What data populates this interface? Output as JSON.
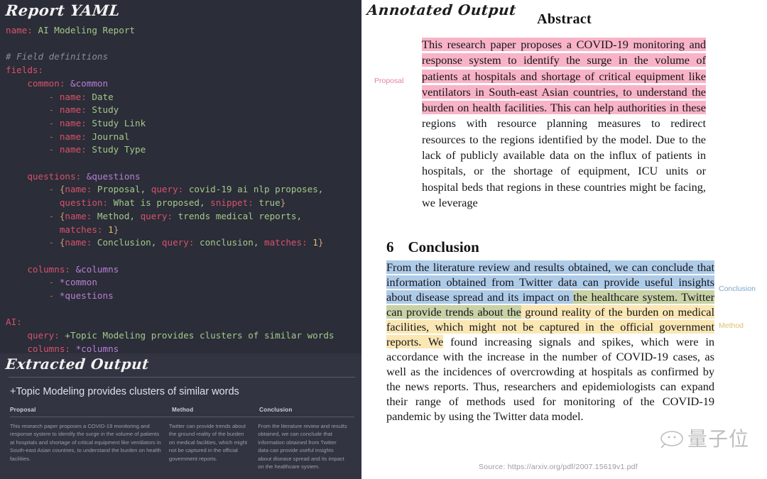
{
  "left": {
    "yaml_panel_title": "Report YAML",
    "yaml_lines": [
      {
        "parts": [
          {
            "t": "name:",
            "c": "k"
          },
          {
            "t": " AI Modeling Report",
            "c": "v"
          }
        ]
      },
      {
        "parts": []
      },
      {
        "parts": [
          {
            "t": "# Field definitions",
            "c": "cm"
          }
        ]
      },
      {
        "parts": [
          {
            "t": "fields:",
            "c": "k"
          }
        ]
      },
      {
        "parts": [
          {
            "t": "    common:",
            "c": "k"
          },
          {
            "t": " ",
            "c": "plain"
          },
          {
            "t": "&common",
            "c": "anch"
          }
        ]
      },
      {
        "parts": [
          {
            "t": "        - ",
            "c": "dash"
          },
          {
            "t": "name:",
            "c": "k"
          },
          {
            "t": " Date",
            "c": "v"
          }
        ]
      },
      {
        "parts": [
          {
            "t": "        - ",
            "c": "dash"
          },
          {
            "t": "name:",
            "c": "k"
          },
          {
            "t": " Study",
            "c": "v"
          }
        ]
      },
      {
        "parts": [
          {
            "t": "        - ",
            "c": "dash"
          },
          {
            "t": "name:",
            "c": "k"
          },
          {
            "t": " Study Link",
            "c": "v"
          }
        ]
      },
      {
        "parts": [
          {
            "t": "        - ",
            "c": "dash"
          },
          {
            "t": "name:",
            "c": "k"
          },
          {
            "t": " Journal",
            "c": "v"
          }
        ]
      },
      {
        "parts": [
          {
            "t": "        - ",
            "c": "dash"
          },
          {
            "t": "name:",
            "c": "k"
          },
          {
            "t": " Study Type",
            "c": "v"
          }
        ]
      },
      {
        "parts": []
      },
      {
        "parts": [
          {
            "t": "    questions:",
            "c": "k"
          },
          {
            "t": " ",
            "c": "plain"
          },
          {
            "t": "&questions",
            "c": "anch"
          }
        ]
      },
      {
        "parts": [
          {
            "t": "        - ",
            "c": "dash"
          },
          {
            "t": "{",
            "c": "punc"
          },
          {
            "t": "name:",
            "c": "k"
          },
          {
            "t": " Proposal, ",
            "c": "v"
          },
          {
            "t": "query:",
            "c": "k"
          },
          {
            "t": " covid-19 ai nlp proposes,",
            "c": "v"
          }
        ]
      },
      {
        "parts": [
          {
            "t": "          ",
            "c": "plain"
          },
          {
            "t": "question:",
            "c": "k"
          },
          {
            "t": " What is proposed, ",
            "c": "v"
          },
          {
            "t": "snippet:",
            "c": "k"
          },
          {
            "t": " true",
            "c": "v"
          },
          {
            "t": "}",
            "c": "punc"
          }
        ]
      },
      {
        "parts": [
          {
            "t": "        - ",
            "c": "dash"
          },
          {
            "t": "{",
            "c": "punc"
          },
          {
            "t": "name:",
            "c": "k"
          },
          {
            "t": " Method, ",
            "c": "v"
          },
          {
            "t": "query:",
            "c": "k"
          },
          {
            "t": " trends medical reports,",
            "c": "v"
          }
        ]
      },
      {
        "parts": [
          {
            "t": "          ",
            "c": "plain"
          },
          {
            "t": "matches:",
            "c": "k"
          },
          {
            "t": " ",
            "c": "v"
          },
          {
            "t": "1",
            "c": "num"
          },
          {
            "t": "}",
            "c": "punc"
          }
        ]
      },
      {
        "parts": [
          {
            "t": "        - ",
            "c": "dash"
          },
          {
            "t": "{",
            "c": "punc"
          },
          {
            "t": "name:",
            "c": "k"
          },
          {
            "t": " Conclusion, ",
            "c": "v"
          },
          {
            "t": "query:",
            "c": "k"
          },
          {
            "t": " conclusion, ",
            "c": "v"
          },
          {
            "t": "matches:",
            "c": "k"
          },
          {
            "t": " ",
            "c": "v"
          },
          {
            "t": "1",
            "c": "num"
          },
          {
            "t": "}",
            "c": "punc"
          }
        ]
      },
      {
        "parts": []
      },
      {
        "parts": [
          {
            "t": "    columns:",
            "c": "k"
          },
          {
            "t": " ",
            "c": "plain"
          },
          {
            "t": "&columns",
            "c": "anch"
          }
        ]
      },
      {
        "parts": [
          {
            "t": "        - ",
            "c": "dash"
          },
          {
            "t": "*common",
            "c": "anch"
          }
        ]
      },
      {
        "parts": [
          {
            "t": "        - ",
            "c": "dash"
          },
          {
            "t": "*questions",
            "c": "anch"
          }
        ]
      },
      {
        "parts": []
      },
      {
        "parts": [
          {
            "t": "AI:",
            "c": "k"
          }
        ]
      },
      {
        "parts": [
          {
            "t": "    query:",
            "c": "k"
          },
          {
            "t": " +Topic Modeling provides clusters of similar words",
            "c": "v"
          }
        ]
      },
      {
        "parts": [
          {
            "t": "    columns:",
            "c": "k"
          },
          {
            "t": " ",
            "c": "plain"
          },
          {
            "t": "*columns",
            "c": "anch"
          }
        ]
      }
    ],
    "extracted": {
      "panel_title": "Extracted Output",
      "query_heading": "+Topic Modeling provides clusters of similar words",
      "columns": [
        "Proposal",
        "Method",
        "Conclusion"
      ],
      "row": [
        "This research paper proposes a COVID-19 monitoring and response system to identify the surge in the volume of patients at hospitals and shortage of critical equipment like ventilators in South-east Asian countries, to understand the burden on health facilities.",
        "Twitter can provide trends about the ground reality of the burden on medical facilities, which might not be captured in the official government reports.",
        "From the literature review and results obtained, we can conclude that information obtained from Twitter data can provide useful insights about disease spread and its impact on the healthcare system."
      ]
    }
  },
  "right": {
    "panel_title": "Annotated Output",
    "abstract_heading": "Abstract",
    "abstract_highlighted": "This research paper proposes a COVID-19 monitoring and response system to identify the surge in the volume of patients at hospitals and shortage of critical equipment like ventilators in South-east Asian countries, to understand the burden on health facilities. This can help authorities in these",
    "abstract_rest": " regions with resource planning measures to redirect resources to the regions identified by the model. Due to the lack of publicly available data on the influx of patients in hospitals, or the shortage of equipment, ICU units or hospital beds that regions in these countries might be facing, we leverage",
    "conclusion_number": "6",
    "conclusion_heading": "Conclusion",
    "conclusion_blue": "From the literature review and results obtained, we can conclude that information obtained from Twitter data can provide useful insights about disease spread and its impact on ",
    "conclusion_green": "the healthcare system. Twitter can provide trends about the",
    "conclusion_yellow": " ground reality of the burden on medical facilities, which might not be captured in the official government reports. We",
    "conclusion_rest": " found increasing signals and spikes, which were in accordance with the increase in the number of COVID-19 cases, as well as the incidences of overcrowding at hospitals as confirmed by the news reports. Thus, researchers and epidemiologists can expand their range of methods used for monitoring of the COVID-19 pandemic by using the Twitter data model.",
    "tags": {
      "proposal": "Proposal",
      "conclusion": "Conclusion",
      "method": "Method"
    },
    "source": "Source: https://arxiv.org/pdf/2007.15619v1.pdf",
    "watermark_text": "量子位"
  },
  "colors": {
    "panel_dark": "#2b2d38",
    "panel_card": "#323441",
    "yaml_key": "#d8526b",
    "yaml_value": "#a3c98a",
    "yaml_anchor": "#b87fd4",
    "highlight_pink": "#f9b3c7",
    "highlight_blue": "#aecbe8",
    "highlight_yellow": "#fae7b4",
    "highlight_green": "#c8d2a6"
  }
}
